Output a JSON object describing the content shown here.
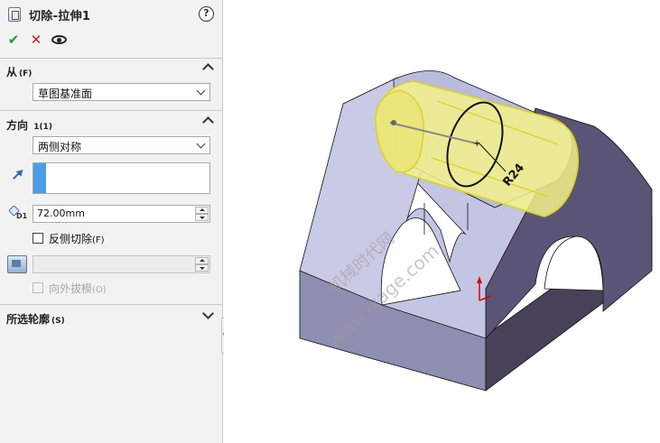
{
  "feature": {
    "title": "切除-拉伸1",
    "help_label": "?",
    "icon": "extruded-cut-icon"
  },
  "actions": {
    "ok_icon": "checkmark-icon",
    "cancel_icon": "close-icon",
    "preview_icon": "eye-icon"
  },
  "from_section": {
    "title": "从",
    "hotkey": "(F)",
    "selected": "草图基准面"
  },
  "direction_section": {
    "title": "方向",
    "number": "1(1)",
    "end_condition": "两侧对称",
    "direction_icon": "reverse-direction-arrow-icon",
    "depth_icon": "depth-d1-icon",
    "depth_value": "72.00mm",
    "flip_side_label": "反侧切除",
    "flip_side_hotkey": "(F)",
    "flip_side_checked": false,
    "draft_icon": "draft-icon",
    "draft_value": "",
    "draft_outward_label": "向外拔模",
    "draft_outward_hotkey": "(O)",
    "draft_outward_enabled": false
  },
  "selected_contours": {
    "title": "所选轮廓",
    "hotkey": "(S)"
  },
  "viewport": {
    "dimension_label": "R24",
    "watermark_line1": "机械时代网",
    "watermark_line2": "www.jxage.com",
    "colors": {
      "model_light": "#c4c6e2",
      "model_mid": "#8c8bb2",
      "model_dark": "#5c5878",
      "preview_yellow": "#f4f28a",
      "preview_edge": "#d9d320",
      "triad_red": "#e00000"
    }
  }
}
